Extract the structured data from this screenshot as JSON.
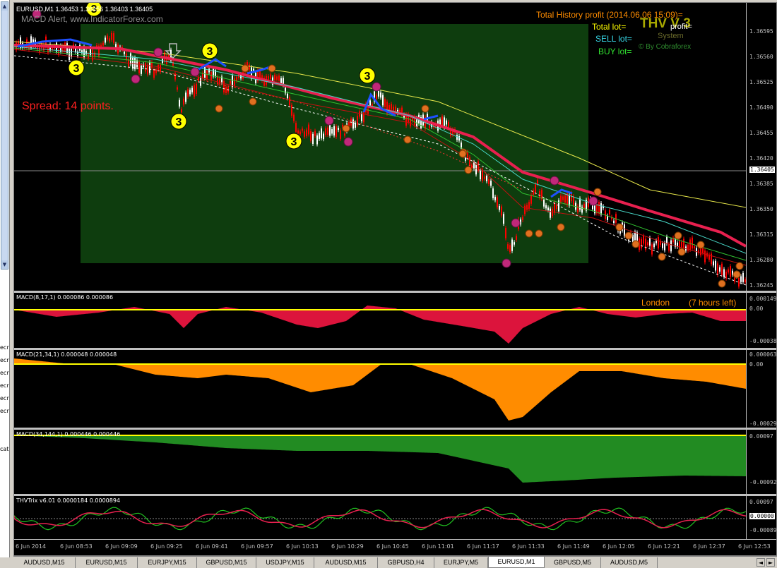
{
  "left_panel": {
    "texts": [
      "ecr",
      "ecr",
      "ecr",
      "ecr",
      "ecr",
      "ecr",
      "cat"
    ]
  },
  "main_chart": {
    "title": "EURUSD,M1  1.36453 1.36456 1.36403 1.36405",
    "alert_text": "MACD Alert, www.IndicatorForex.com",
    "spread": "Spread: 14 points.",
    "history_profit": "Total History profit (2014.06.06 15:09)=",
    "total_lot": "Total  lot=",
    "profit": "profit=",
    "sell_lot": "SELL  lot=",
    "buy_lot": "BUY  lot=",
    "thv_logo": "THV V 3",
    "system": "System",
    "cobraforex": "© By Cobraforex",
    "price_labels": [
      "1.36595",
      "1.36560",
      "1.36525",
      "1.36490",
      "1.36455",
      "1.36420",
      "1.36405",
      "1.36385",
      "1.36350",
      "1.36315",
      "1.36280",
      "1.36245"
    ],
    "current_price": "1.36405",
    "signal_numbers": [
      "3",
      "3",
      "3",
      "3",
      "3",
      "3",
      "3"
    ],
    "colors": {
      "background": "#000000",
      "box": "#0e3d0e",
      "bull": "#ffffff",
      "bear": "#ff0000",
      "ma_red": "#e8204f",
      "ma_yellow": "#e8e84a",
      "ma_cyan": "#48d8c8",
      "ma_green": "#30c030"
    }
  },
  "macd1": {
    "title": "MACD(8,17,1) 0.000086 0.000086",
    "london": "London",
    "hours_left": "(7 hours left)",
    "labels": [
      "0.000149",
      "0.00",
      "-0.000383"
    ],
    "color": "#dc143c"
  },
  "macd2": {
    "title": "MACD(21,34,1) 0.000048 0.000048",
    "labels": [
      "0.000063",
      "0.00",
      "-0.00029"
    ],
    "color": "#ff8c00"
  },
  "macd3": {
    "title": "MACD(34,144,1) 0.000446 0.000446",
    "labels": [
      "0.00097",
      "-0.000923"
    ],
    "color": "#228b22"
  },
  "trix": {
    "title": "THVTrix v6.01 0.0000184 0.0000894",
    "labels": [
      "0.00097",
      "0.00000",
      "-0.00089"
    ]
  },
  "time_labels": [
    "6 Jun 2014",
    "6 Jun 08:53",
    "6 Jun 09:09",
    "6 Jun 09:25",
    "6 Jun 09:41",
    "6 Jun 09:57",
    "6 Jun 10:13",
    "6 Jun 10:29",
    "6 Jun 10:45",
    "6 Jun 11:01",
    "6 Jun 11:17",
    "6 Jun 11:33",
    "6 Jun 11:49",
    "6 Jun 12:05",
    "6 Jun 12:21",
    "6 Jun 12:37",
    "6 Jun 12:53"
  ],
  "tabs": [
    {
      "label": "AUDUSD,M15",
      "active": false
    },
    {
      "label": "EURUSD,M15",
      "active": false
    },
    {
      "label": "EURJPY,M15",
      "active": false
    },
    {
      "label": "GBPUSD,M15",
      "active": false
    },
    {
      "label": "USDJPY,M15",
      "active": false
    },
    {
      "label": "AUDUSD,M15",
      "active": false
    },
    {
      "label": "GBPUSD,H4",
      "active": false
    },
    {
      "label": "EURJPY,M5",
      "active": false
    },
    {
      "label": "EURUSD,M1",
      "active": true
    },
    {
      "label": "GBPUSD,M5",
      "active": false
    },
    {
      "label": "AUDUSD,M5",
      "active": false
    }
  ],
  "tab_nav": {
    "left": "◄",
    "right": "►"
  }
}
